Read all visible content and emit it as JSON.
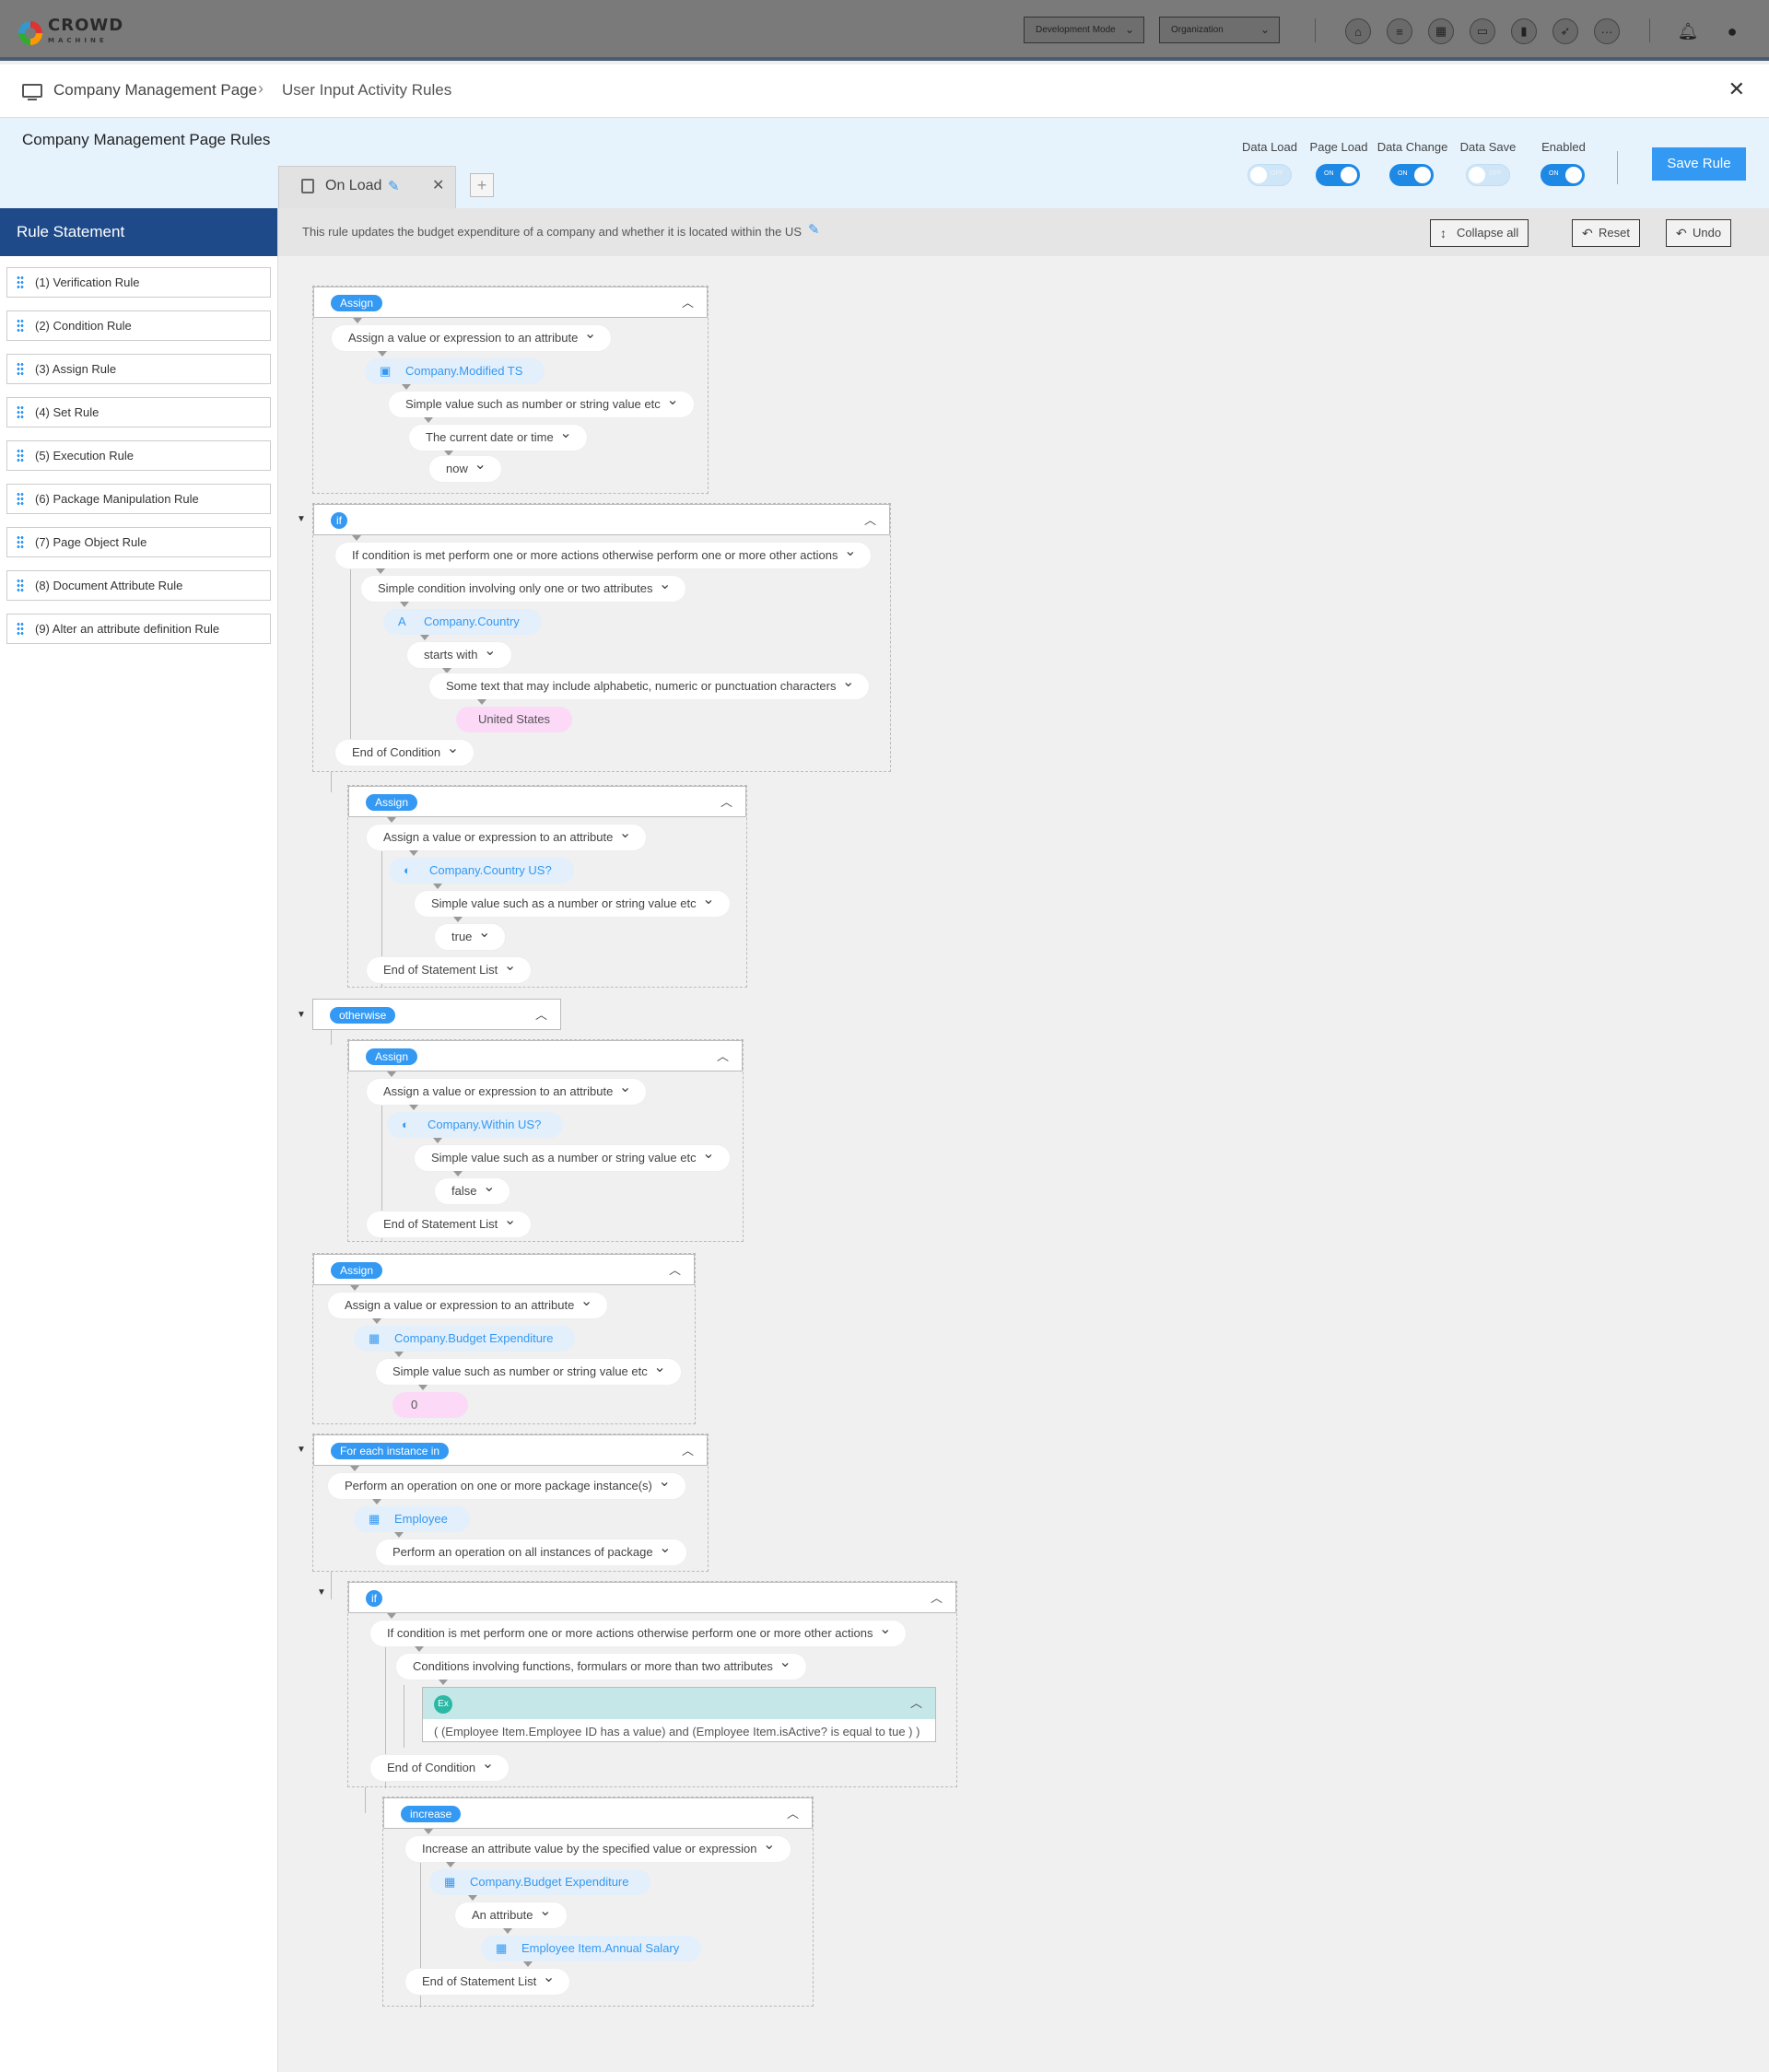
{
  "topbar": {
    "logo_text": "CROWD",
    "logo_sub": "MACHINE",
    "mode_select": "Development Mode",
    "org_select": "Organization"
  },
  "breadcrumb": {
    "page": "Company Management Page",
    "current": "User Input Activity Rules"
  },
  "rule_header": {
    "title": "Company Management Page Rules",
    "toggles": [
      {
        "label": "Data Load",
        "state": "OFF"
      },
      {
        "label": "Page Load",
        "state": "ON"
      },
      {
        "label": "Data Change",
        "state": "ON"
      },
      {
        "label": "Data Save",
        "state": "OFF"
      },
      {
        "label": "Enabled",
        "state": "ON"
      }
    ],
    "save_label": "Save Rule"
  },
  "tab": {
    "label": "On Load",
    "add": "+"
  },
  "sidebar": {
    "title": "Rule Statement",
    "items": [
      "(1) Verification Rule",
      "(2) Condition Rule",
      "(3) Assign Rule",
      "(4) Set Rule",
      "(5) Execution Rule",
      "(6) Package Manipulation Rule",
      "(7) Page Object Rule",
      "(8) Document Attribute Rule",
      "(9) Alter an attribute definition Rule"
    ]
  },
  "description": {
    "text": "This rule updates the budget expenditure of a company and whether it is located within the US",
    "collapse_label": "Collapse all",
    "reset_label": "Reset",
    "undo_label": "Undo"
  },
  "rules": {
    "assign1": {
      "pill": "Assign",
      "n1": "Assign a value or expression to an attribute",
      "attr": "Company.Modified TS",
      "n2": "Simple value such as number or string value etc",
      "n3": "The current date or time",
      "n4": "now"
    },
    "if1": {
      "pill": "if",
      "n1": "If condition is met perform one or more actions otherwise perform one or more other actions",
      "n2": "Simple condition involving only one or two attributes",
      "attr": "Company.Country",
      "n3": "starts with",
      "n4": "Some text that may include alphabetic, numeric or punctuation characters",
      "val": "United States",
      "end": "End of Condition"
    },
    "assign2": {
      "pill": "Assign",
      "n1": "Assign a value or expression to an attribute",
      "attr": "Company.Country US?",
      "n2": "Simple value such as a number or string value etc",
      "n3": "true",
      "end": "End of Statement List"
    },
    "otherwise": {
      "pill": "otherwise"
    },
    "assign3": {
      "pill": "Assign",
      "n1": "Assign a value or expression to an attribute",
      "attr": "Company.Within US?",
      "n2": "Simple value such as a number or string value etc",
      "n3": "false",
      "end": "End of Statement List"
    },
    "assign4": {
      "pill": "Assign",
      "n1": "Assign a value or expression to an attribute",
      "attr": "Company.Budget Expenditure",
      "n2": "Simple value such as number or string value etc",
      "val": "0"
    },
    "foreach": {
      "pill": "For each instance in",
      "n1": "Perform an operation on one or more package instance(s)",
      "attr": "Employee",
      "n2": "Perform an operation on all instances of package"
    },
    "if2": {
      "pill": "if",
      "n1": "If condition is met perform one or more actions otherwise perform one or more other actions",
      "n2": "Conditions involving functions, formulars or more than two attributes",
      "ex_pill": "Ex",
      "ex_text": "( (Employee Item.Employee ID has a value) and (Employee Item.isActive? is equal to tue ) )",
      "end": "End of Condition"
    },
    "increase": {
      "pill": "increase",
      "n1": "Increase an attribute value by the specified value or expression",
      "attr1": "Company.Budget Expenditure",
      "n2": "An attribute",
      "attr2": "Employee Item.Annual Salary",
      "end": "End of Statement List"
    }
  },
  "colors": {
    "accent": "#3399f3",
    "sidebar_header": "#1f4a8a",
    "header_bg": "#e6f3fd",
    "value_pill": "#fbd9f7"
  }
}
